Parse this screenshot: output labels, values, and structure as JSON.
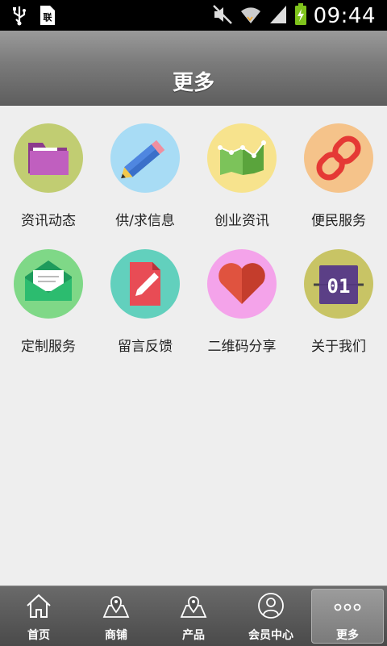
{
  "status_bar": {
    "time": "09:44",
    "icons": [
      "usb-icon",
      "sim-icon",
      "mute-icon",
      "wifi-icon",
      "signal-icon",
      "battery-charging-icon"
    ]
  },
  "header": {
    "title": "更多"
  },
  "grid": {
    "items": [
      {
        "label": "资讯动态",
        "icon": "folder-icon",
        "bg": "#c1cd72"
      },
      {
        "label": "供/求信息",
        "icon": "pencil-icon",
        "bg": "#a8dcf5"
      },
      {
        "label": "创业资讯",
        "icon": "growth-chart-icon",
        "bg": "#f7e38d"
      },
      {
        "label": "便民服务",
        "icon": "link-icon",
        "bg": "#f5c38a"
      },
      {
        "label": "定制服务",
        "icon": "envelope-icon",
        "bg": "#7fd887"
      },
      {
        "label": "留言反馈",
        "icon": "edit-document-icon",
        "bg": "#62d0bd"
      },
      {
        "label": "二维码分享",
        "icon": "heart-icon",
        "bg": "#f4a3ea"
      },
      {
        "label": "关于我们",
        "icon": "calendar-icon",
        "bg": "#c8c465",
        "icon_text": "01"
      }
    ]
  },
  "tabbar": {
    "tabs": [
      {
        "label": "首页",
        "icon": "home-icon",
        "active": false
      },
      {
        "label": "商铺",
        "icon": "map-icon",
        "active": false
      },
      {
        "label": "产品",
        "icon": "map-icon",
        "active": false
      },
      {
        "label": "会员中心",
        "icon": "user-icon",
        "active": false
      },
      {
        "label": "更多",
        "icon": "more-dots-icon",
        "active": true
      }
    ]
  }
}
